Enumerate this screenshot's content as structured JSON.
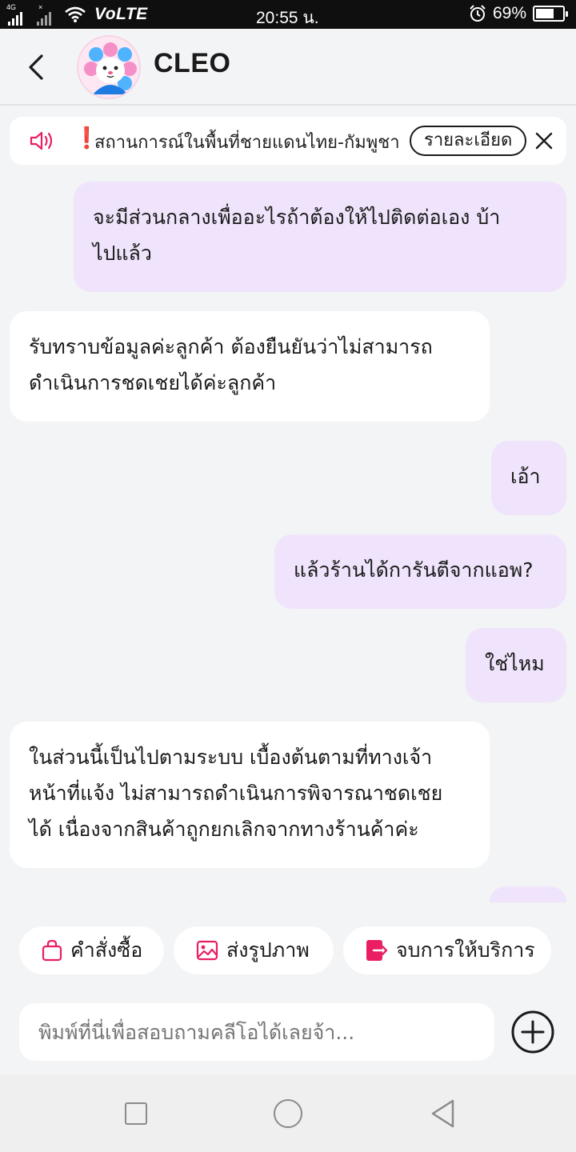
{
  "status_bar": {
    "network": "4G",
    "volte": "VoLTE",
    "time": "20:55 น.",
    "battery_percent": "69%",
    "battery_level": 0.69
  },
  "header": {
    "title": "CLEO",
    "back_icon": "chevron-left-icon",
    "avatar_icon": "cleo-mascot-avatar"
  },
  "announcement": {
    "text": "สถานการณ์ในพื้นที่ชายแดนไทย-กัมพูชา",
    "excl": "❗",
    "detail_label": "รายละเอียด",
    "speaker_icon": "speaker-icon",
    "speaker_color": "#e91e63"
  },
  "messages": [
    {
      "from": "me",
      "lines": [
        "จะมีส่วนกลางเพื่ออะไรถ้าต้องให้ไปติดต่อเอง บ้า",
        "ไปแล้ว"
      ]
    },
    {
      "from": "them",
      "lines": [
        "รับทราบข้อมูลค่ะลูกค้า ต้องยืนยันว่าไม่สามารถ",
        "ดำเนินการชดเชยได้ค่ะลูกค้า"
      ]
    },
    {
      "from": "me",
      "lines": [
        "เอ้า"
      ]
    },
    {
      "from": "me",
      "lines": [
        "แล้วร้านได้การันตีจากแอพ?"
      ]
    },
    {
      "from": "me",
      "lines": [
        "ใช่ไหม"
      ]
    },
    {
      "from": "them",
      "lines": [
        "ในส่วนนี้เป็นไปตามระบบ เบื้องต้นตามที่ทางเจ้า",
        "หน้าที่แจ้ง ไม่สามารถดำเนินการพิจารณาชดเชย",
        "ได้ เนื่องจากสินค้าถูกยกเลิกจากทางร้านค้าค่ะ"
      ]
    }
  ],
  "quick_actions": [
    {
      "label": "คำสั่งซื้อ",
      "icon": "shopping-bag-icon"
    },
    {
      "label": "ส่งรูปภาพ",
      "icon": "image-icon"
    },
    {
      "label": "จบการให้บริการ",
      "icon": "exit-icon"
    }
  ],
  "input": {
    "placeholder": "พิมพ์ที่นี่เพื่อสอบถามคลีโอได้เลยจ้า...",
    "value": ""
  },
  "colors": {
    "accent": "#e91e63",
    "user_bubble": "#efe4fb",
    "bot_bubble": "#ffffff",
    "background": "#f3f4f6"
  }
}
